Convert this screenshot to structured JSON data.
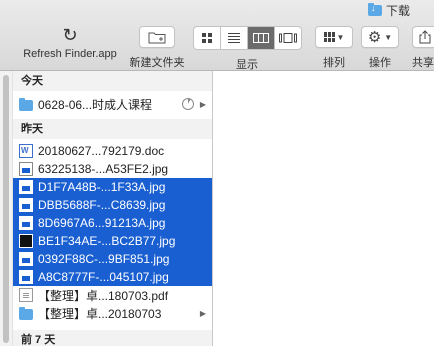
{
  "window": {
    "title": "下载"
  },
  "toolbar": {
    "refresh_label": "Refresh Finder.app",
    "new_folder_label": "新建文件夹",
    "view_label": "显示",
    "arrange_label": "排列",
    "action_label": "操作",
    "share_label": "共享",
    "active_view": "columns"
  },
  "sections": {
    "today": "今天",
    "yesterday": "昨天",
    "last7": "前 7 天"
  },
  "today_items": [
    {
      "name": "0628-06...时成人课程",
      "type": "folder",
      "progress": 0.08
    }
  ],
  "yesterday_items": [
    {
      "name": "20180627...792179.doc",
      "type": "doc",
      "selected": false
    },
    {
      "name": "63225138-...A53FE2.jpg",
      "type": "jpg",
      "selected": false
    },
    {
      "name": "D1F7A48B-...1F33A.jpg",
      "type": "jpg",
      "selected": true
    },
    {
      "name": "DBB5688F-...C8639.jpg",
      "type": "jpg",
      "selected": true
    },
    {
      "name": "8D6967A6...91213A.jpg",
      "type": "jpg",
      "selected": true
    },
    {
      "name": "BE1F34AE-...BC2B77.jpg",
      "type": "jpg-dark",
      "selected": true
    },
    {
      "name": "0392F88C-...9BF851.jpg",
      "type": "jpg",
      "selected": true
    },
    {
      "name": "A8C8777F-...045107.jpg",
      "type": "jpg",
      "selected": true
    },
    {
      "name": "【整理】卓...180703.pdf",
      "type": "pdf",
      "selected": false
    },
    {
      "name": "【整理】卓...20180703",
      "type": "folder",
      "selected": false
    }
  ],
  "colors": {
    "selection": "#1a5fd1",
    "folder": "#5aa9e6"
  }
}
